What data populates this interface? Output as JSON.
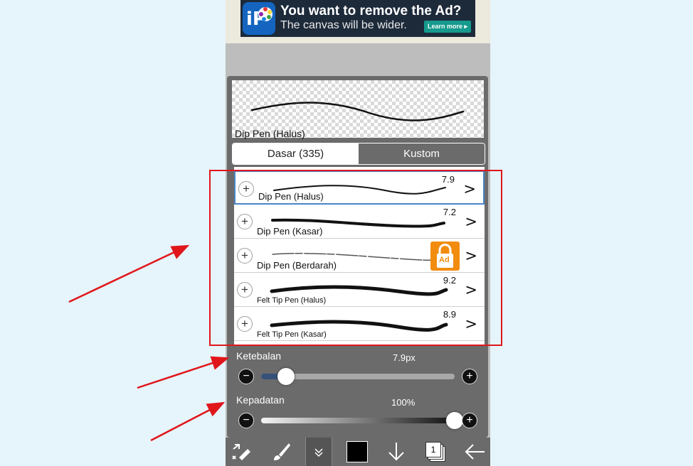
{
  "ad": {
    "logo_text": "iP",
    "title": "You want to remove the Ad?",
    "subtitle": "The canvas will be wider.",
    "button": "Learn more ▸"
  },
  "brush_panel": {
    "preview_label": "Dip Pen (Halus)",
    "tabs": [
      {
        "label": "Dasar (335)",
        "selected": true
      },
      {
        "label": "Kustom",
        "selected": false
      }
    ],
    "brushes": [
      {
        "name": "Dip Pen (Halus)",
        "value": "7.9",
        "selected": true
      },
      {
        "name": "Dip Pen (Kasar)",
        "value": "7.2"
      },
      {
        "name": "Dip Pen (Berdarah)",
        "value": "",
        "locked": true,
        "lock_badge": "Ad"
      },
      {
        "name": "Felt Tip Pen (Halus)",
        "value": "9.2"
      },
      {
        "name": "Felt Tip Pen (Kasar)",
        "value": "8.9"
      }
    ],
    "plus_symbol": "+",
    "chevron_symbol": ">",
    "thickness": {
      "label": "Ketebalan",
      "value": "7.9px",
      "level": 0.13
    },
    "density": {
      "label": "Kepadatan",
      "value": "100%",
      "level": 1.0
    },
    "minus_symbol": "−"
  },
  "toolbar": {
    "layer_count": "1",
    "icons": [
      "swap-tool-icon",
      "brush-icon",
      "collapse-icon",
      "color-swatch",
      "download-arrow-icon",
      "layers-icon",
      "back-arrow-icon"
    ]
  },
  "colors": {
    "accent": "#4a86c8",
    "annotation": "#e0161b",
    "lock": "#f28c0f"
  }
}
